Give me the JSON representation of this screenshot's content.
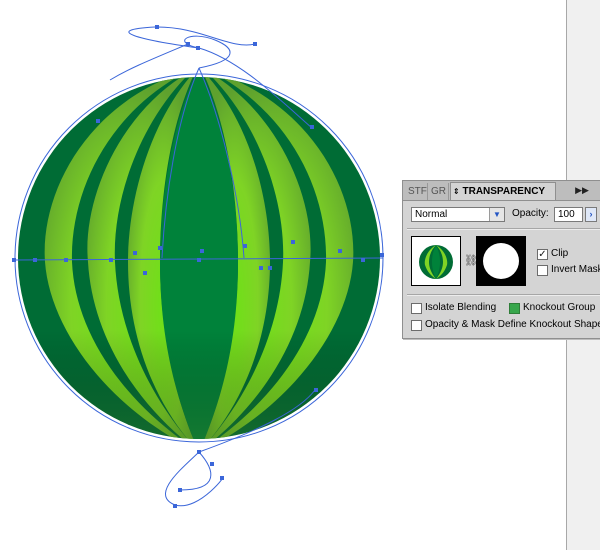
{
  "artboard": {
    "object": "watermelon-sphere",
    "colors": {
      "dark_green": "#006c35",
      "mid_green": "#00823a",
      "light_green": "#83d32a",
      "path_blue": "#3b66d9"
    }
  },
  "transparency_panel": {
    "tabs": [
      "STF",
      "GR",
      "TRANSPARENCY"
    ],
    "blend_mode": "Normal",
    "opacity_label": "Opacity:",
    "opacity_value": "100",
    "clip_label": "Clip",
    "clip_checked": true,
    "invert_mask_label": "Invert Mask",
    "invert_mask_checked": false,
    "isolate_blending_label": "Isolate Blending",
    "isolate_blending_checked": false,
    "knockout_group_label": "Knockout Group",
    "knockout_group_checked": true,
    "opacity_mask_label": "Opacity & Mask Define Knockout Shape",
    "opacity_mask_checked": false
  }
}
